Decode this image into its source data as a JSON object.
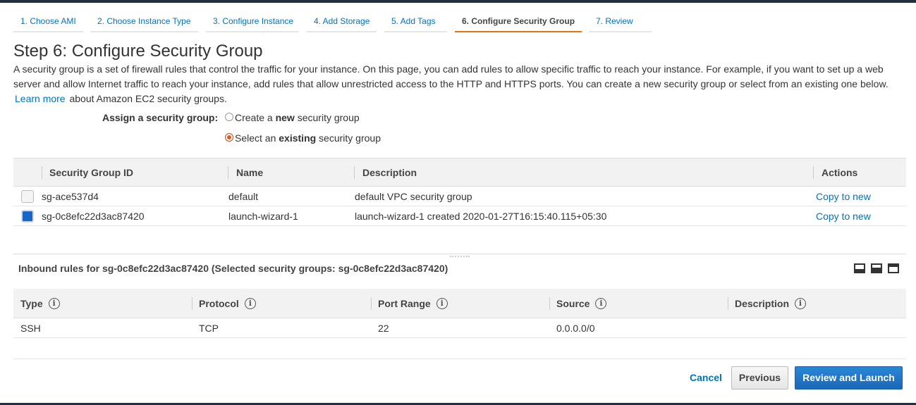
{
  "wizard": {
    "tabs": [
      {
        "label": "1. Choose AMI"
      },
      {
        "label": "2. Choose Instance Type"
      },
      {
        "label": "3. Configure Instance"
      },
      {
        "label": "4. Add Storage"
      },
      {
        "label": "5. Add Tags"
      },
      {
        "label": "6. Configure Security Group",
        "active": true
      },
      {
        "label": "7. Review"
      }
    ]
  },
  "page": {
    "title": "Step 6: Configure Security Group",
    "description": "A security group is a set of firewall rules that control the traffic for your instance. On this page, you can add rules to allow specific traffic to reach your instance. For example, if you want to set up a web server and allow Internet traffic to reach your instance, add rules that allow unrestricted access to the HTTP and HTTPS ports. You can create a new security group or select from an existing one below.",
    "learn_more": "Learn more",
    "learn_more_suffix": "about Amazon EC2 security groups."
  },
  "assign": {
    "label": "Assign a security group:",
    "option_new_pre": "Create a ",
    "option_new_bold": "new",
    "option_new_post": " security group",
    "option_existing_pre": "Select an ",
    "option_existing_bold": "existing",
    "option_existing_post": " security group",
    "selected": "existing"
  },
  "sg_table": {
    "headers": {
      "id": "Security Group ID",
      "name": "Name",
      "description": "Description",
      "actions": "Actions"
    },
    "rows": [
      {
        "id": "sg-ace537d4",
        "name": "default",
        "description": "default VPC security group",
        "action": "Copy to new",
        "checked": false
      },
      {
        "id": "sg-0c8efc22d3ac87420",
        "name": "launch-wizard-1",
        "description": "launch-wizard-1 created 2020-01-27T16:15:40.115+05:30",
        "action": "Copy to new",
        "checked": true
      }
    ]
  },
  "inbound": {
    "title": "Inbound rules for sg-0c8efc22d3ac87420 (Selected security groups: sg-0c8efc22d3ac87420)",
    "headers": {
      "type": "Type",
      "protocol": "Protocol",
      "port_range": "Port Range",
      "source": "Source",
      "description": "Description"
    },
    "info_glyph": "i",
    "rows": [
      {
        "type": "SSH",
        "protocol": "TCP",
        "port_range": "22",
        "source": "0.0.0.0/0",
        "description": ""
      }
    ]
  },
  "footer": {
    "cancel": "Cancel",
    "previous": "Previous",
    "review_launch": "Review and Launch"
  },
  "colors": {
    "link": "#0073bb",
    "active_tab_underline": "#ec7211",
    "primary_button": "#1b68b8",
    "radio_selected": "#e2571e"
  }
}
